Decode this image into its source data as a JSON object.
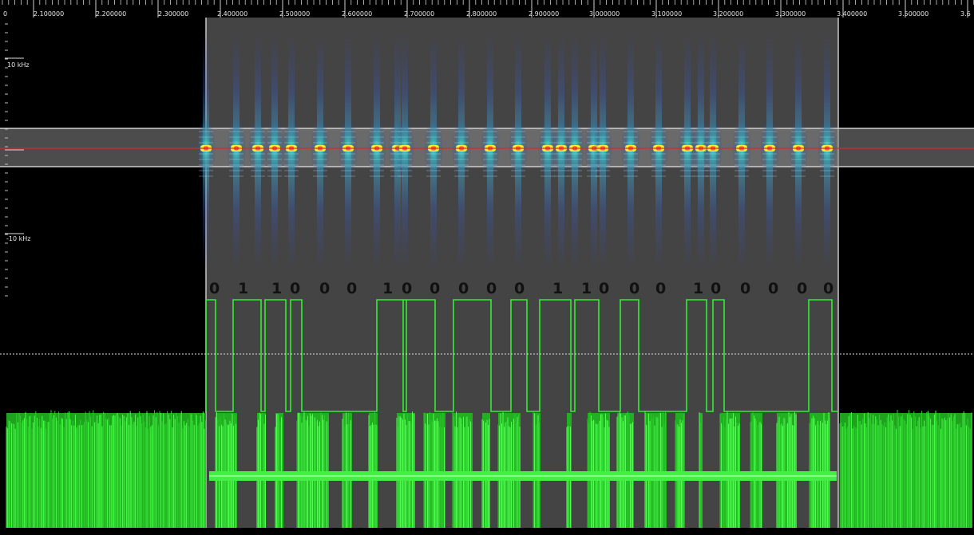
{
  "viewer": {
    "time_ruler": {
      "labels": [
        "0",
        "2.100000",
        "2.200000",
        "2.300000",
        "2.400000",
        "2.500000",
        "2.600000",
        "2.700000",
        "2.800000",
        "2.900000",
        "3.000000",
        "3.100000",
        "3.200000",
        "3.300000",
        "3.400000",
        "3.500000",
        "3.6"
      ]
    },
    "frequency_axis": {
      "upper_label": "10 kHz",
      "lower_label": "-10 kHz"
    },
    "selection": {
      "decoded_bits": [
        "0",
        "1",
        "1",
        "0",
        "0",
        "0",
        "1",
        "0",
        "0",
        "0",
        "0",
        "0",
        "1",
        "1",
        "0",
        "0",
        "0",
        "1",
        "0",
        "0",
        "0",
        "0",
        "0"
      ]
    },
    "colors": {
      "background": "#000000",
      "selection_shade": "#4d4d4d",
      "center_line": "#d42a2a",
      "waveform": "#33ee33",
      "signal_peak": "#ffee33",
      "signal_core": "#ff5533",
      "signal_glow": "#33c0b8"
    }
  }
}
